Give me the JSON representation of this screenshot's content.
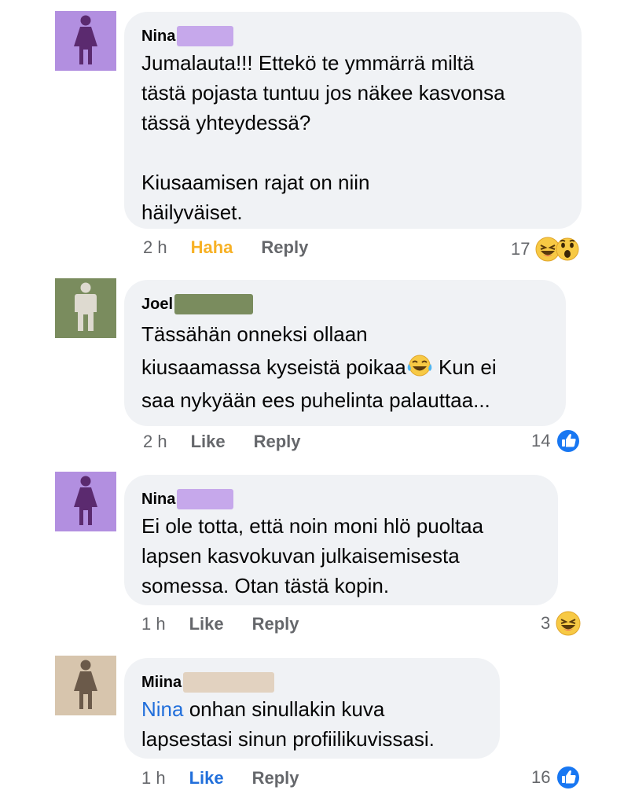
{
  "comments": [
    {
      "name": "Nina",
      "avatar_color": "#b28fe0",
      "avatar_figure": "female",
      "avatar_icon": "female-silhouette-icon",
      "redaction_color": "#c6a8eb",
      "lines": [
        "Jumalauta!!! Ettekö te ymmärrä miltä",
        "tästä pojasta tuntuu jos näkee kasvonsa",
        "tässä yhteydessä?",
        "",
        "Kiusaamisen rajat on niin",
        "häilyväiset."
      ],
      "time": "2 h",
      "reaction_action": "Haha",
      "reply": "Reply",
      "reaction_count": "17",
      "reaction_icons": [
        "haha-emoji-icon",
        "wow-emoji-icon"
      ]
    },
    {
      "name": "Joel",
      "avatar_color": "#7a8c5e",
      "avatar_figure": "male",
      "avatar_icon": "male-silhouette-icon",
      "redaction_color": "#7a8c5e",
      "line1": "Tässähän onneksi ollaan",
      "line2_a": "kiusaamassa kyseistä poikaa",
      "line2_b": " Kun ei",
      "line3": "saa nykyään ees puhelinta palauttaa...",
      "time": "2 h",
      "reaction_action": "Like",
      "reply": "Reply",
      "reaction_count": "14",
      "reaction_icons": [
        "like-thumb-icon"
      ]
    },
    {
      "name": "Nina",
      "avatar_color": "#b28fe0",
      "avatar_figure": "female",
      "avatar_icon": "female-silhouette-icon",
      "redaction_color": "#c6a8eb",
      "lines": [
        "Ei ole totta, että noin moni hlö puoltaa",
        "lapsen kasvokuvan julkaisemisesta",
        "somessa. Otan tästä kopin."
      ],
      "time": "1 h",
      "reaction_action": "Like",
      "reply": "Reply",
      "reaction_count": "3",
      "reaction_icons": [
        "haha-emoji-icon"
      ]
    },
    {
      "name": "Miina",
      "avatar_color": "#d7c5ad",
      "avatar_figure": "female",
      "avatar_icon": "female-silhouette-icon",
      "redaction_color": "#e2d2c0",
      "mention": "Nina",
      "line1_rest": " onhan sinullakin kuva",
      "line2": "lapsestasi sinun profiilikuvissasi.",
      "time": "1 h",
      "reaction_action": "Like",
      "reply": "Reply",
      "reaction_count": "16",
      "reaction_icons": [
        "like-thumb-icon"
      ]
    }
  ],
  "colors": {
    "bubble": "#f0f2f5",
    "meta_text": "#65676b",
    "haha_active": "#f7b125",
    "like_active": "#216fdb",
    "mention": "#216fdb"
  }
}
